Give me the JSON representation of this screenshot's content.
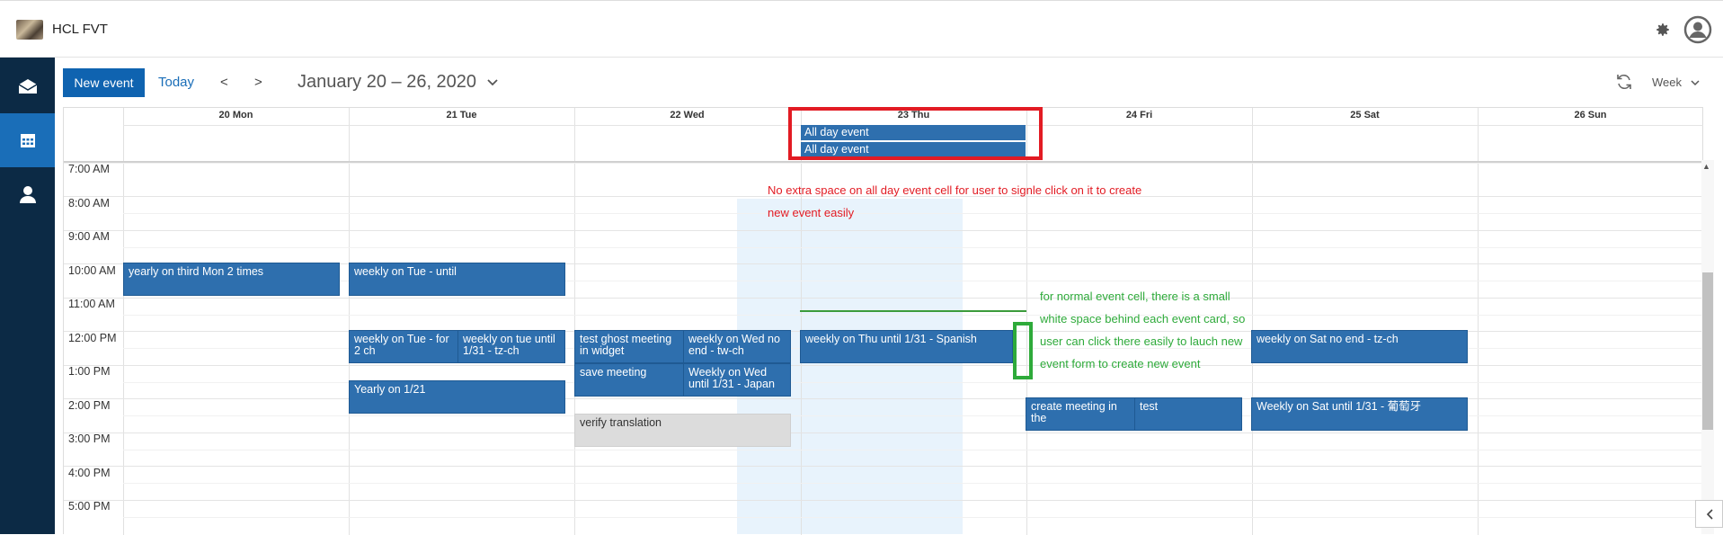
{
  "app": {
    "title": "HCL FVT"
  },
  "toolbar": {
    "new_event": "New event",
    "today": "Today",
    "prev": "<",
    "next": ">",
    "range": "January 20 – 26, 2020",
    "view": "Week"
  },
  "days": [
    "20 Mon",
    "21 Tue",
    "22 Wed",
    "23 Thu",
    "24 Fri",
    "25 Sat",
    "26 Sun"
  ],
  "times": [
    "7:00 AM",
    "8:00 AM",
    "9:00 AM",
    "10:00 AM",
    "11:00 AM",
    "12:00 PM",
    "1:00 PM",
    "2:00 PM",
    "3:00 PM",
    "4:00 PM",
    "5:00 PM"
  ],
  "allday_events": [
    "All day event",
    "All day event"
  ],
  "events": {
    "mon_yearly": "yearly on third Mon 2 times",
    "tue_weekly_until": "weekly on Tue - until",
    "tue_weekly_for": "weekly on Tue - for 2 ch",
    "tue_weekly_tue_until": "weekly on tue until 1/31 - tz-ch",
    "tue_yearly": "Yearly on 1/21",
    "wed_ghost": "test ghost meeting in widget",
    "wed_weekly_no_end": "weekly on Wed no end - tw-ch",
    "wed_save": "save meeting",
    "wed_weekly_japan": "Weekly on Wed until 1/31 - Japan",
    "wed_verify": "verify translation",
    "thu_weekly_spanish": "weekly on Thu until 1/31 - Spanish",
    "fri_create": "create meeting in the",
    "fri_test": "test",
    "sat_no_end": "weekly on Sat no end - tz-ch",
    "sat_until": "Weekly on Sat until 1/31 - 葡萄牙"
  },
  "annotations": {
    "red": "No extra space on all day event cell for user to signle click on it to create new event easily",
    "green": "for normal event cell, there is a small white space behind each event card, so user can click there easily to lauch new event form to create new event"
  },
  "colors": {
    "brand": "#0f63b0",
    "sidebar": "#0c2a45",
    "event": "#2e6fae",
    "annotation_red": "#e21b23",
    "annotation_green": "#2eaa3a"
  },
  "icons": {
    "settings": "gear-icon",
    "profile": "user-icon",
    "mail": "mail-icon",
    "calendar": "calendar-icon",
    "contacts": "person-icon",
    "refresh": "refresh-icon"
  }
}
